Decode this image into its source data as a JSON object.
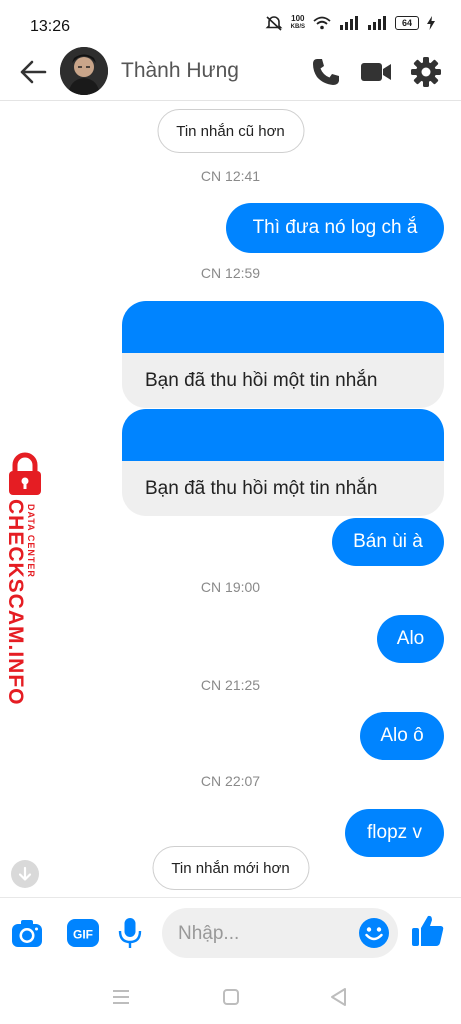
{
  "status_bar": {
    "time": "13:26",
    "net_speed_value": "100",
    "net_speed_unit": "KB/S",
    "battery": "64"
  },
  "header": {
    "contact_name": "Thành Hưng",
    "icons": [
      "back-arrow-icon",
      "phone-icon",
      "video-camera-icon",
      "gear-icon"
    ]
  },
  "chat": {
    "older_button": "Tin nhắn cũ hơn",
    "newer_button": "Tin nhắn mới hơn",
    "timestamps": [
      "CN 12:41",
      "CN 12:59",
      "CN 19:00",
      "CN 21:25",
      "CN 22:07"
    ],
    "messages": [
      "Thì đưa nó log ch ắ",
      "Bạn đã thu hồi một tin nhắn",
      "Bạn đã thu hồi một tin nhắn",
      "Bán ùi à",
      "Alo",
      "Alo ô",
      "flopz v"
    ],
    "accent_color": "#0084ff"
  },
  "watermark": {
    "line_small": "DATA CENTER",
    "line_large": "CHECKSCAM.INFO",
    "color": "#e51d23"
  },
  "composer": {
    "placeholder": "Nhập...",
    "gif_label": "GIF",
    "icons": [
      "camera-icon",
      "gif-icon",
      "microphone-icon",
      "emoji-icon",
      "thumbs-up-icon"
    ]
  },
  "nav_bar": {
    "icons": [
      "recents-menu-icon",
      "home-square-icon",
      "back-triangle-icon"
    ]
  }
}
